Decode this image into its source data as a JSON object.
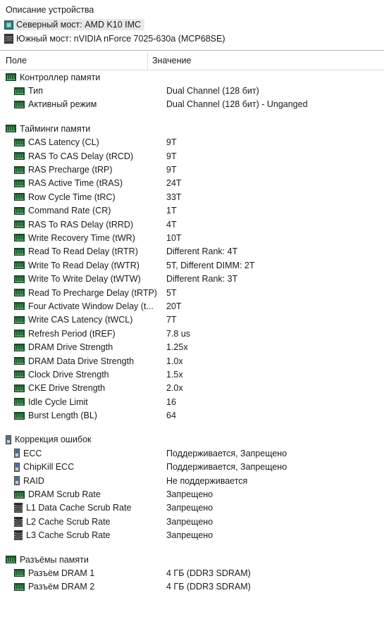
{
  "device_pane": {
    "title": "Описание устройства",
    "rows": [
      {
        "icon": "northbridge-chip-icon",
        "label": "Северный мост: AMD K10 IMC",
        "selected": true
      },
      {
        "icon": "southbridge-chip-icon",
        "label": "Южный мост: nVIDIA nForce 7025-630a (MCP68SE)",
        "selected": false
      }
    ]
  },
  "grid": {
    "header": {
      "field": "Поле",
      "value": "Значение"
    },
    "rows": [
      {
        "type": "group",
        "icon": "dimm-icon",
        "label": "Контроллер памяти",
        "value": ""
      },
      {
        "type": "item",
        "icon": "dimm-icon",
        "label": "Тип",
        "value": "Dual Channel  (128 бит)"
      },
      {
        "type": "item",
        "icon": "dimm-icon",
        "label": "Активный режим",
        "value": "Dual Channel  (128 бит) - Unganged"
      },
      {
        "type": "spacer"
      },
      {
        "type": "group",
        "icon": "dimm-icon",
        "label": "Тайминги памяти",
        "value": ""
      },
      {
        "type": "item",
        "icon": "dimm-icon",
        "label": "CAS Latency (CL)",
        "value": "9T"
      },
      {
        "type": "item",
        "icon": "dimm-icon",
        "label": "RAS To CAS Delay (tRCD)",
        "value": "9T"
      },
      {
        "type": "item",
        "icon": "dimm-icon",
        "label": "RAS Precharge (tRP)",
        "value": "9T"
      },
      {
        "type": "item",
        "icon": "dimm-icon",
        "label": "RAS Active Time (tRAS)",
        "value": "24T"
      },
      {
        "type": "item",
        "icon": "dimm-icon",
        "label": "Row Cycle Time (tRC)",
        "value": "33T"
      },
      {
        "type": "item",
        "icon": "dimm-icon",
        "label": "Command Rate (CR)",
        "value": "1T"
      },
      {
        "type": "item",
        "icon": "dimm-icon",
        "label": "RAS To RAS Delay (tRRD)",
        "value": "4T"
      },
      {
        "type": "item",
        "icon": "dimm-icon",
        "label": "Write Recovery Time (tWR)",
        "value": "10T"
      },
      {
        "type": "item",
        "icon": "dimm-icon",
        "label": "Read To Read Delay (tRTR)",
        "value": "Different Rank: 4T"
      },
      {
        "type": "item",
        "icon": "dimm-icon",
        "label": "Write To Read Delay (tWTR)",
        "value": "5T, Different DIMM: 2T"
      },
      {
        "type": "item",
        "icon": "dimm-icon",
        "label": "Write To Write Delay (tWTW)",
        "value": "Different Rank: 3T"
      },
      {
        "type": "item",
        "icon": "dimm-icon",
        "label": "Read To Precharge Delay (tRTP)",
        "value": "5T"
      },
      {
        "type": "item",
        "icon": "dimm-icon",
        "label": "Four Activate Window Delay (t...",
        "value": "20T"
      },
      {
        "type": "item",
        "icon": "dimm-icon",
        "label": "Write CAS Latency (tWCL)",
        "value": "7T"
      },
      {
        "type": "item",
        "icon": "dimm-icon",
        "label": "Refresh Period (tREF)",
        "value": "7.8 us"
      },
      {
        "type": "item",
        "icon": "dimm-icon",
        "label": "DRAM Drive Strength",
        "value": "1.25x"
      },
      {
        "type": "item",
        "icon": "dimm-icon",
        "label": "DRAM Data Drive Strength",
        "value": "1.0x"
      },
      {
        "type": "item",
        "icon": "dimm-icon",
        "label": "Clock Drive Strength",
        "value": "1.5x"
      },
      {
        "type": "item",
        "icon": "dimm-icon",
        "label": "CKE Drive Strength",
        "value": "2.0x"
      },
      {
        "type": "item",
        "icon": "dimm-icon",
        "label": "Idle Cycle Limit",
        "value": "16"
      },
      {
        "type": "item",
        "icon": "dimm-icon",
        "label": "Burst Length (BL)",
        "value": "64"
      },
      {
        "type": "spacer"
      },
      {
        "type": "group",
        "icon": "ecc-chip-icon",
        "label": "Коррекция ошибок",
        "value": ""
      },
      {
        "type": "item",
        "icon": "ecc-chip-icon",
        "label": "ECC",
        "value": "Поддерживается, Запрещено"
      },
      {
        "type": "item",
        "icon": "ecc-chip-icon",
        "label": "ChipKill ECC",
        "value": "Поддерживается, Запрещено"
      },
      {
        "type": "item",
        "icon": "ecc-chip-icon",
        "label": "RAID",
        "value": "Не поддерживается"
      },
      {
        "type": "item",
        "icon": "dimm-icon",
        "label": "DRAM Scrub Rate",
        "value": "Запрещено"
      },
      {
        "type": "item",
        "icon": "cache-chip-icon",
        "label": "L1 Data Cache Scrub Rate",
        "value": "Запрещено"
      },
      {
        "type": "item",
        "icon": "cache-chip-icon",
        "label": "L2 Cache Scrub Rate",
        "value": "Запрещено"
      },
      {
        "type": "item",
        "icon": "cache-chip-icon",
        "label": "L3 Cache Scrub Rate",
        "value": "Запрещено"
      },
      {
        "type": "spacer"
      },
      {
        "type": "group",
        "icon": "dimm-icon",
        "label": "Разъёмы памяти",
        "value": ""
      },
      {
        "type": "item",
        "icon": "dimm-icon",
        "label": "Разъём DRAM 1",
        "value": "4 ГБ  (DDR3 SDRAM)"
      },
      {
        "type": "item",
        "icon": "dimm-icon",
        "label": "Разъём DRAM 2",
        "value": "4 ГБ  (DDR3 SDRAM)"
      }
    ]
  }
}
